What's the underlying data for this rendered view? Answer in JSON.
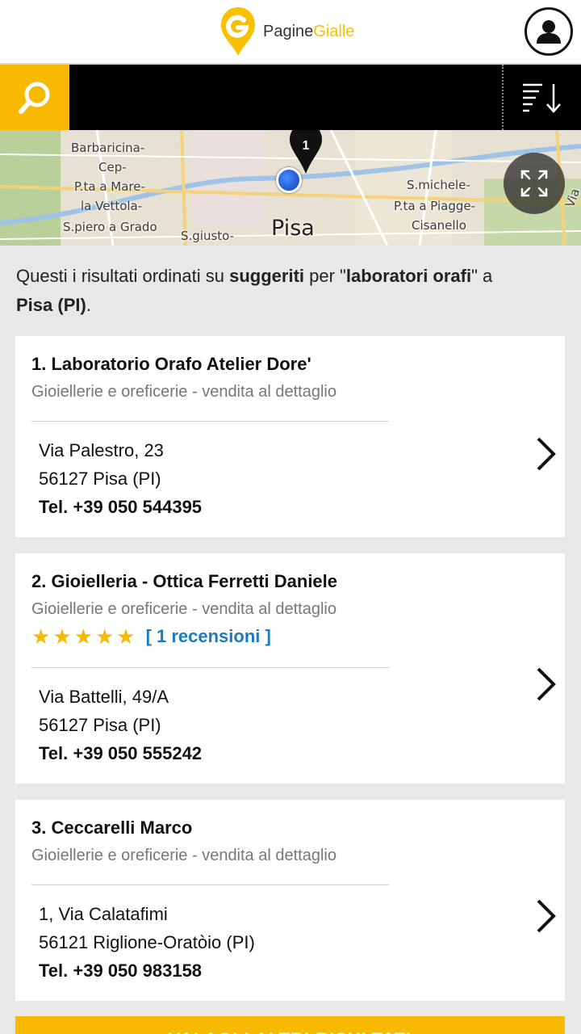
{
  "header": {
    "logo_text_a": "Pagine",
    "logo_text_b": "Gialle",
    "colors": {
      "brand": "#f8b900",
      "toolbar": "#000000",
      "link": "#1a7bbf"
    }
  },
  "toolbar": {
    "search_icon": "search-icon",
    "sort_icon": "sort-icon"
  },
  "map": {
    "labels": [
      "Barbaricina-",
      "Cep-",
      "P.ta a Mare-",
      "la Vettola-",
      "S.piero a Grado",
      "S.giusto-",
      "Pisa",
      "S.michele-",
      "P.ta a Piagge-",
      "Cisanello",
      "Via"
    ],
    "pin_number": "1"
  },
  "intro": {
    "t1": "Questi i risultati ordinati su ",
    "sort": "suggeriti",
    "t2": " per \"",
    "query": "laboratori orafi",
    "t3": "\" a",
    "place": "Pisa (PI)",
    "t4": "."
  },
  "results": [
    {
      "name": "1. Laboratorio Orafo Atelier Dore'",
      "category": "Gioiellerie e oreficerie - vendita al dettaglio",
      "street": "Via Palestro, 23",
      "city": "56127 Pisa (PI)",
      "tel": "Tel. +39 050 544395"
    },
    {
      "name": "2. Gioielleria - Ottica Ferretti Daniele",
      "category": "Gioiellerie e oreficerie - vendita al dettaglio",
      "rating": 5,
      "reviews": "[ 1 recensioni ]",
      "street": "Via Battelli, 49/A",
      "city": "56127 Pisa (PI)",
      "tel": "Tel. +39 050 555242"
    },
    {
      "name": "3. Ceccarelli Marco",
      "category": "Gioiellerie e oreficerie - vendita al dettaglio",
      "street": "1, Via Calatafimi",
      "city": "56121 Riglione-Oratòio (PI)",
      "tel": "Tel. +39 050 983158"
    }
  ],
  "more_button": "VAI AGLI ALTRI RISULTATI"
}
